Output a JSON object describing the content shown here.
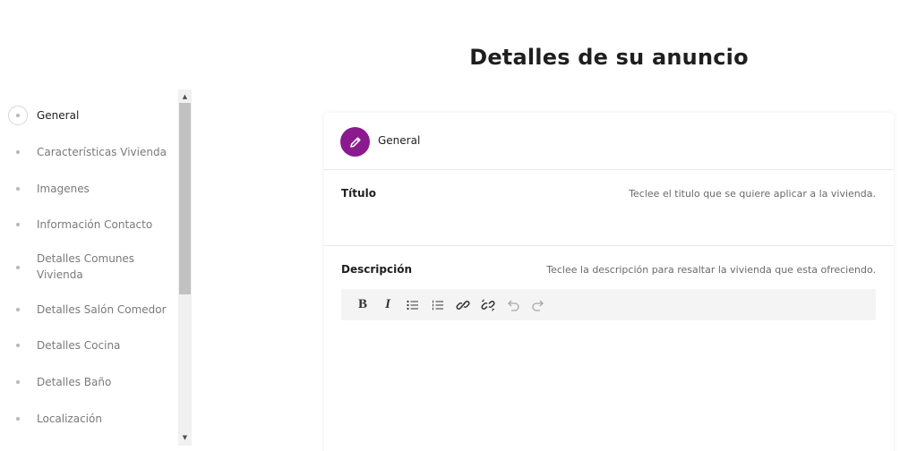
{
  "page": {
    "title": "Detalles de su anuncio"
  },
  "sidebar": {
    "items": [
      {
        "label": "General",
        "active": true
      },
      {
        "label": "Características Vivienda",
        "active": false
      },
      {
        "label": "Imagenes",
        "active": false
      },
      {
        "label": "Información Contacto",
        "active": false
      },
      {
        "label": "Detalles Comunes Vivienda",
        "active": false
      },
      {
        "label": "Detalles Salón Comedor",
        "active": false
      },
      {
        "label": "Detalles Cocina",
        "active": false
      },
      {
        "label": "Detalles Baño",
        "active": false
      },
      {
        "label": "Localización",
        "active": false
      }
    ],
    "scroll_up_glyph": "▲",
    "scroll_down_glyph": "▼"
  },
  "card": {
    "title": "General",
    "icon": "pencil-icon",
    "accent_color": "#8b1a8e",
    "fields": {
      "titulo": {
        "label": "Título",
        "hint": "Teclee el titulo que se quiere aplicar a la vivienda."
      },
      "descripcion": {
        "label": "Descripción",
        "hint": "Teclee la descripción para resaltar la vivienda que esta ofreciendo."
      }
    },
    "toolbar": {
      "bold": "B",
      "italic": "I",
      "bullet_list": "bullet-list-icon",
      "numbered_list": "numbered-list-icon",
      "link": "link-icon",
      "unlink": "unlink-icon",
      "undo": "undo-icon",
      "redo": "redo-icon"
    }
  }
}
